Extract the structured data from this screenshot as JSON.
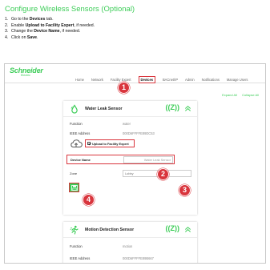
{
  "doc": {
    "title": "Configure Wireless Sensors (Optional)",
    "steps": [
      {
        "num": "1.",
        "pre": "Go to the ",
        "bold": "Devices",
        "post": " tab."
      },
      {
        "num": "2.",
        "pre": "Enable ",
        "bold": "Upload to Facility Expert",
        "post": ", if needed."
      },
      {
        "num": "3.",
        "pre": "Change the ",
        "bold": "Device Name",
        "post": ", if needed."
      },
      {
        "num": "4.",
        "pre": "Click on ",
        "bold": "Save",
        "post": "."
      }
    ]
  },
  "app": {
    "logo": "Schneider",
    "logo_sub": "Electric",
    "nav": [
      "Home",
      "Network",
      "Facility Expert",
      "Devices",
      "BACnet/IP",
      "Admin",
      "Notifications",
      "Manage Users"
    ],
    "active_nav": "Devices",
    "expand_all": "Expand All",
    "collapse_all": "Collapse All",
    "zigbee_mark": "((Z))"
  },
  "callouts": [
    "1",
    "2",
    "3",
    "4"
  ],
  "panel1": {
    "name": "Water Leak Sensor",
    "function_label": "Function",
    "function_value": "water",
    "ieee_label": "IEEE Address",
    "ieee_value": "000D6FFFFE89DC53",
    "upload_label": "Upload to Facility Expert",
    "upload_checked": true,
    "device_name_label": "Device Name",
    "device_name_value": "Water Leak Sensor",
    "zone_label": "Zone",
    "zone_placeholder": "Lobby"
  },
  "panel2": {
    "name": "Motion Detection Sensor",
    "function_label": "Function",
    "function_value": "motion",
    "ieee_label": "IEEE Address",
    "ieee_value": "000D6FFFFE89B667"
  },
  "colors": {
    "accent": "#3dcd58",
    "callout": "#d9353d"
  }
}
